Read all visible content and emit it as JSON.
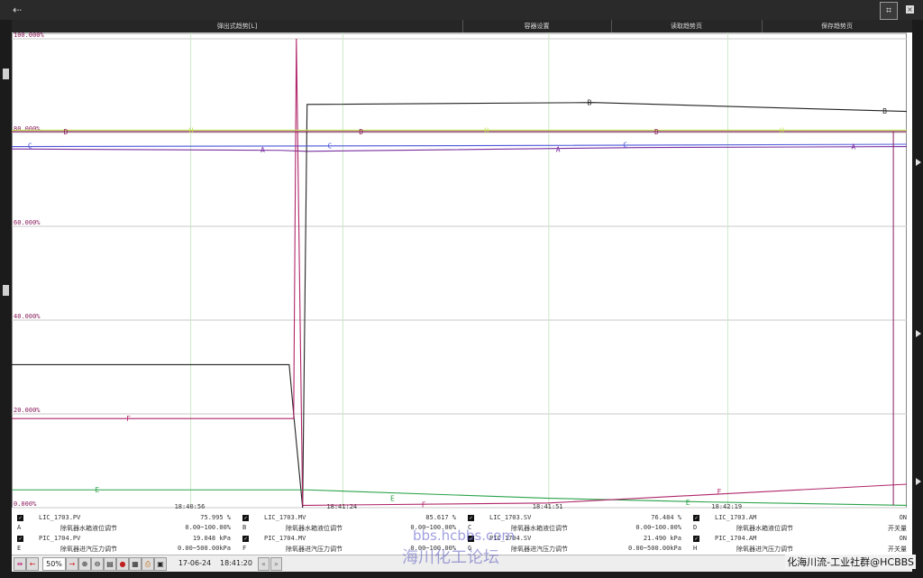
{
  "menu": {
    "items": [
      "弹出式趋势[L]",
      "容器设置",
      "读取趋势页",
      "保存趋势页"
    ]
  },
  "chart_data": {
    "type": "line",
    "ylabel_ticks": [
      "100.000%",
      "80.000%",
      "60.000%",
      "40.000%",
      "20.000%",
      "0.000%"
    ],
    "xlabel_ticks": [
      "18:40:56",
      "18:41:24",
      "18:41:51",
      "18:42:19"
    ],
    "ylim": [
      0,
      100
    ],
    "grid": true,
    "series": [
      {
        "name": "A",
        "color": "#7a2fa0",
        "x": [
          0,
          0.3,
          0.33,
          0.7,
          1.0
        ],
        "y": [
          76.5,
          76.2,
          76.0,
          76.8,
          77.0
        ]
      },
      {
        "name": "B",
        "color": "#222222",
        "x": [
          0,
          0.31,
          0.315,
          0.325,
          0.33,
          0.65,
          1.0
        ],
        "y": [
          30.5,
          30.5,
          20.0,
          0,
          86.0,
          86.4,
          84.5
        ]
      },
      {
        "name": "C",
        "color": "#4c56d8",
        "x": [
          0,
          0.5,
          1.0
        ],
        "y": [
          77.0,
          77.2,
          77.5
        ]
      },
      {
        "name": "D",
        "color": "#8a1a5a",
        "x": [
          0,
          1.0
        ],
        "y": [
          80.2,
          80.2
        ]
      },
      {
        "name": "E",
        "color": "#2aa34a",
        "x": [
          0,
          0.33,
          0.6,
          0.78,
          1.0
        ],
        "y": [
          3.8,
          3.8,
          2.0,
          1.2,
          0.5
        ]
      },
      {
        "name": "F",
        "color": "#b0266a",
        "x": [
          0,
          0.31,
          0.315,
          0.318,
          0.325,
          0.33,
          0.6,
          1.0
        ],
        "y": [
          19.0,
          19.0,
          19.0,
          100.0,
          0.5,
          0.5,
          1.0,
          5.0
        ]
      },
      {
        "name": "H",
        "color": "#c0e050",
        "x": [
          0,
          0.4,
          0.6,
          1.0
        ],
        "y": [
          80.5,
          80.5,
          80.5,
          80.5
        ]
      }
    ],
    "markers": [
      {
        "s": "D",
        "x": 0.06,
        "y": 80.2
      },
      {
        "s": "D",
        "x": 0.39,
        "y": 80.2
      },
      {
        "s": "D",
        "x": 0.72,
        "y": 80.2
      },
      {
        "s": "C",
        "x": 0.02,
        "y": 77.2
      },
      {
        "s": "C",
        "x": 0.355,
        "y": 77.2
      },
      {
        "s": "C",
        "x": 0.685,
        "y": 77.4
      },
      {
        "s": "A",
        "x": 0.28,
        "y": 76.3
      },
      {
        "s": "A",
        "x": 0.61,
        "y": 76.4
      },
      {
        "s": "A",
        "x": 0.94,
        "y": 77.0
      },
      {
        "s": "B",
        "x": 0.645,
        "y": 86.4
      },
      {
        "s": "B",
        "x": 0.975,
        "y": 84.6
      },
      {
        "s": "H",
        "x": 0.2,
        "y": 80.5
      },
      {
        "s": "H",
        "x": 0.53,
        "y": 80.5
      },
      {
        "s": "H",
        "x": 0.86,
        "y": 80.5
      },
      {
        "s": "E",
        "x": 0.095,
        "y": 3.8
      },
      {
        "s": "E",
        "x": 0.425,
        "y": 2.0
      },
      {
        "s": "E",
        "x": 0.755,
        "y": 1.2
      },
      {
        "s": "F",
        "x": 0.13,
        "y": 19.0
      },
      {
        "s": "F",
        "x": 0.46,
        "y": 0.7
      },
      {
        "s": "F",
        "x": 0.79,
        "y": 3.5
      }
    ]
  },
  "legend": [
    {
      "tag": "LIC_1703.PV",
      "val": "75.995 %",
      "let": "A",
      "desc": "除氧器水箱液位调节",
      "rng": "0.00~100.00%"
    },
    {
      "tag": "LIC_1703.MV",
      "val": "85.617 %",
      "let": "B",
      "desc": "除氧器水箱液位调节",
      "rng": "0.00~100.00%"
    },
    {
      "tag": "LIC_1703.SV",
      "val": "76.484 %",
      "let": "C",
      "desc": "除氧器水箱液位调节",
      "rng": "0.00~100.00%"
    },
    {
      "tag": "LIC_1703.AM",
      "val": "ON",
      "let": "D",
      "desc": "除氧器水箱液位调节",
      "rng": "开关量"
    },
    {
      "tag": "PIC_1704.PV",
      "val": "19.048 kPa",
      "let": "E",
      "desc": "除氧器进汽压力调节",
      "rng": "0.00~500.00kPa"
    },
    {
      "tag": "PIC_1704.MV",
      "val": "",
      "let": "F",
      "desc": "除氧器进汽压力调节",
      "rng": "0.00~100.00%"
    },
    {
      "tag": "PIC_1704.SV",
      "val": "21.490 kPa",
      "let": "G",
      "desc": "除氧器进汽压力调节",
      "rng": "0.00~500.00kPa"
    },
    {
      "tag": "PIC_1704.AM",
      "val": "ON",
      "let": "H",
      "desc": "除氧器进汽压力调节",
      "rng": "开关量"
    }
  ],
  "toolbar": {
    "zoom": "50%",
    "date": "17-06-24",
    "time": "18:41:20"
  },
  "watermark": {
    "url": "bbs.hcbbs.com",
    "cn": "海川化工论坛",
    "footer": "化海川流-工业社群@HCBBS"
  }
}
